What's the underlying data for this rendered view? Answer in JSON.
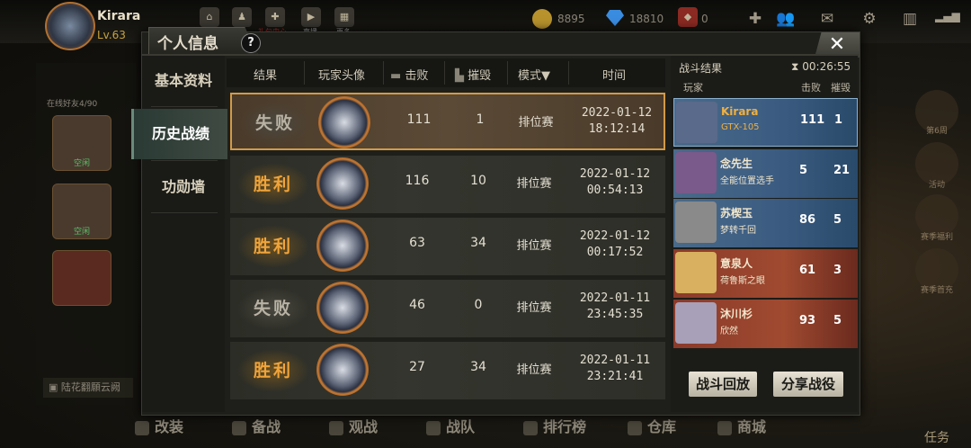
{
  "player": {
    "name": "Kirara",
    "level": "Lv.63"
  },
  "currency": {
    "gold": "8895",
    "diamonds": "18810",
    "tickets": "0"
  },
  "top_icons": [
    "home-icon",
    "character-icon",
    "gift-icon",
    "video-icon",
    "grid-icon"
  ],
  "top_icon_labels": [
    "",
    "",
    "礼包中心",
    "直播",
    "更多"
  ],
  "dialog": {
    "title": "个人信息",
    "help": "?",
    "close": "✕"
  },
  "menu": [
    {
      "label": "基本资料",
      "active": false
    },
    {
      "label": "历史战绩",
      "active": true
    },
    {
      "label": "功勋墙",
      "active": false
    }
  ],
  "table": {
    "headers": {
      "result": "结果",
      "avatar": "玩家头像",
      "kills": "击败",
      "destroys": "摧毁",
      "mode": "模式▼",
      "time": "时间"
    },
    "rows": [
      {
        "result": "失败",
        "win": false,
        "kills": "111",
        "destroys": "1",
        "mode": "排位赛",
        "date": "2022-01-12",
        "clock": "18:12:14",
        "selected": true
      },
      {
        "result": "胜利",
        "win": true,
        "kills": "116",
        "destroys": "10",
        "mode": "排位赛",
        "date": "2022-01-12",
        "clock": "00:54:13",
        "selected": false
      },
      {
        "result": "胜利",
        "win": true,
        "kills": "63",
        "destroys": "34",
        "mode": "排位赛",
        "date": "2022-01-12",
        "clock": "00:17:52",
        "selected": false
      },
      {
        "result": "失败",
        "win": false,
        "kills": "46",
        "destroys": "0",
        "mode": "排位赛",
        "date": "2022-01-11",
        "clock": "23:45:35",
        "selected": false
      },
      {
        "result": "胜利",
        "win": true,
        "kills": "27",
        "destroys": "34",
        "mode": "排位赛",
        "date": "2022-01-11",
        "clock": "23:21:41",
        "selected": false
      }
    ]
  },
  "battle_result": {
    "title": "战斗结果",
    "timer": "00:26:55",
    "col_player": "玩家",
    "col_kills": "击败",
    "col_destroys": "摧毁",
    "players": [
      {
        "name": "Kirara",
        "tag": "GTX-105",
        "kills": "111",
        "destroys": "1",
        "team": "blue"
      },
      {
        "name": "念先生",
        "tag": "全能位置选手",
        "kills": "5",
        "destroys": "21",
        "team": "blue"
      },
      {
        "name": "苏楔玉",
        "tag": "梦转千回",
        "kills": "86",
        "destroys": "5",
        "team": "blue"
      },
      {
        "name": "意泉人",
        "tag": "荷鲁斯之眼",
        "kills": "61",
        "destroys": "3",
        "team": "red"
      },
      {
        "name": "沐川杉",
        "tag": "欣然",
        "kills": "93",
        "destroys": "5",
        "team": "red"
      }
    ],
    "replay_button": "战斗回放",
    "share_button": "分享战役"
  },
  "left_panel": {
    "friends_label": "在线好友4/90",
    "slot_label": "空闲",
    "chat_text": "陆花翻願云阙"
  },
  "right_side": [
    "第6周",
    "活动",
    "赛季福利",
    "赛季首充",
    "任务"
  ],
  "bottom_nav": [
    "改装",
    "备战",
    "观战",
    "战队",
    "排行榜",
    "仓库",
    "商城"
  ]
}
